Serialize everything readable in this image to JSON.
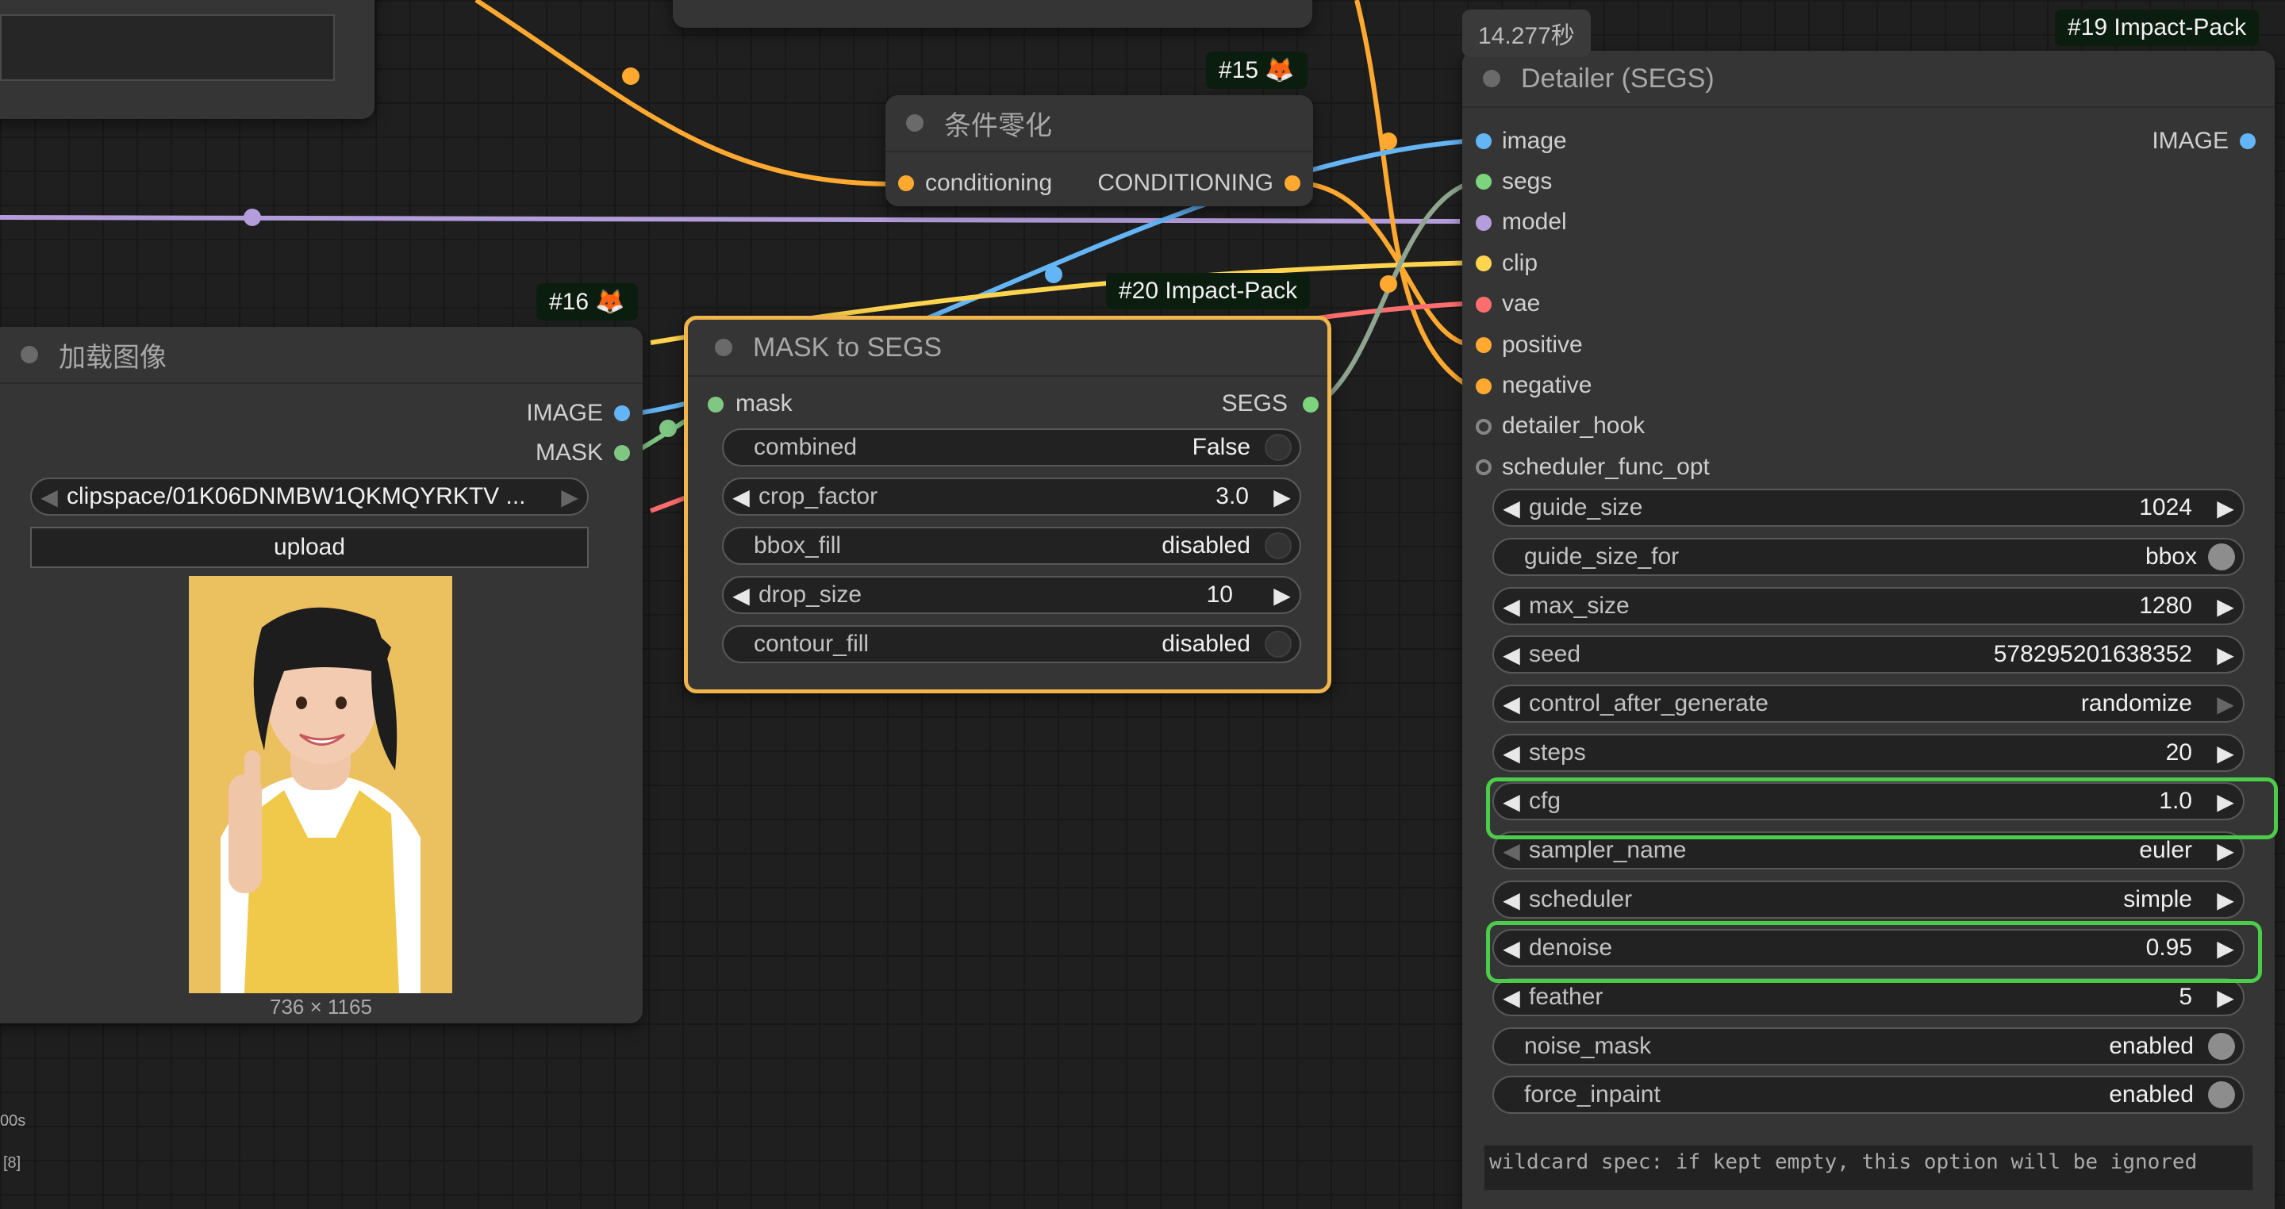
{
  "timing": "14.277秒",
  "colors": {
    "image": "#64b5f6",
    "segs": "#7cd47c",
    "model": "#b39ddb",
    "clip": "#ffd54f",
    "vae": "#ff6e6e",
    "conditioning": "#ffa931",
    "mask": "#81c784",
    "segs_wire": "#8fa58f"
  },
  "nodes": {
    "zero_cond": {
      "badge": "#15 🦊",
      "title": "条件零化",
      "input": "conditioning",
      "output": "CONDITIONING"
    },
    "load_image": {
      "badge": "#16 🦊",
      "title": "加载图像",
      "outputs": [
        "IMAGE",
        "MASK"
      ],
      "file": "clipspace/01K06DNMBW1QKMQYRKTV ...",
      "upload": "upload",
      "size_caption": "736 × 1165"
    },
    "mask_to_segs": {
      "badge": "#20 Impact-Pack",
      "title": "MASK to SEGS",
      "input": "mask",
      "output": "SEGS",
      "widgets": [
        {
          "name": "combined",
          "value": "False"
        },
        {
          "name": "crop_factor",
          "value": "3.0"
        },
        {
          "name": "bbox_fill",
          "value": "disabled"
        },
        {
          "name": "drop_size",
          "value": "10"
        },
        {
          "name": "contour_fill",
          "value": "disabled"
        }
      ]
    },
    "detailer": {
      "badge": "#19 Impact-Pack",
      "title": "Detailer (SEGS)",
      "inputs": [
        "image",
        "segs",
        "model",
        "clip",
        "vae",
        "positive",
        "negative",
        "detailer_hook",
        "scheduler_func_opt"
      ],
      "output": "IMAGE",
      "widgets": [
        {
          "name": "guide_size",
          "value": "1024"
        },
        {
          "name": "guide_size_for",
          "value": "bbox"
        },
        {
          "name": "max_size",
          "value": "1280"
        },
        {
          "name": "seed",
          "value": "578295201638352"
        },
        {
          "name": "control_after_generate",
          "value": "randomize"
        },
        {
          "name": "steps",
          "value": "20"
        },
        {
          "name": "cfg",
          "value": "1.0"
        },
        {
          "name": "sampler_name",
          "value": "euler"
        },
        {
          "name": "scheduler",
          "value": "simple"
        },
        {
          "name": "denoise",
          "value": "0.95"
        },
        {
          "name": "feather",
          "value": "5"
        },
        {
          "name": "noise_mask",
          "value": "enabled"
        },
        {
          "name": "force_inpaint",
          "value": "enabled"
        }
      ],
      "wildcard": "wildcard spec: if kept empty, this option will be ignored"
    }
  },
  "corner": {
    "a": "00s",
    "b": "[8]"
  }
}
